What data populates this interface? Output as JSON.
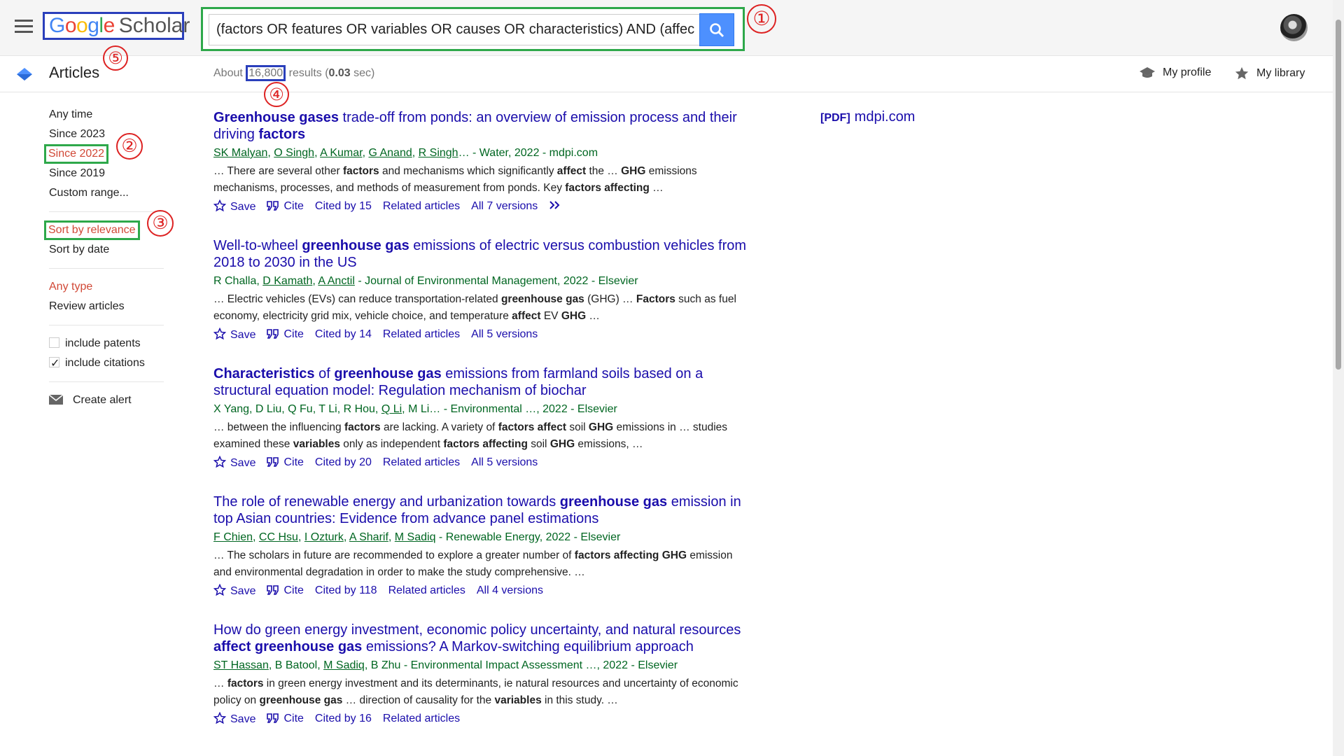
{
  "header": {
    "logo": {
      "g1": "G",
      "g2": "o",
      "g3": "o",
      "g4": "g",
      "g5": "l",
      "g6": "e",
      "scholar": "Scholar"
    },
    "search_value": "(factors OR features OR variables OR causes OR characteristics) AND (affec",
    "annotation_1": "①",
    "annotation_5": "⑤"
  },
  "subbar": {
    "section": "Articles",
    "results_prefix": "About ",
    "results_count": "16,800",
    "results_suffix": " results (",
    "results_time": "0.03",
    "results_end": " sec)",
    "annotation_4": "④",
    "my_profile": "My profile",
    "my_library": "My library"
  },
  "sidebar": {
    "time_filters": [
      "Any time",
      "Since 2023",
      "Since 2022",
      "Since 2019",
      "Custom range..."
    ],
    "annotation_2": "②",
    "sort_relevance": "Sort by relevance",
    "annotation_3": "③",
    "sort_date": "Sort by date",
    "type_any": "Any type",
    "type_review": "Review articles",
    "include_patents": "include patents",
    "include_citations": "include citations",
    "create_alert": "Create alert"
  },
  "pdf_link": {
    "tag": "[PDF]",
    "domain": "mdpi.com"
  },
  "actions": {
    "save": "Save",
    "cite": "Cite"
  },
  "results": [
    {
      "t1": "Greenhouse gases",
      "t2": " trade-off from ponds: an overview of emission process and their driving ",
      "t3": "factors",
      "t4": "",
      "a1": "SK Malyan",
      "a2": "O Singh",
      "a3": "A Kumar",
      "a4": "G Anand",
      "a5": "R Singh",
      "a6": "… - Water, 2022 - mdpi.com",
      "s1": "… There are several other ",
      "s2": "factors",
      "s3": " and mechanisms which significantly ",
      "s4": "affect",
      "s5": " the … ",
      "s6": "GHG",
      "s7": " emissions mechanisms, processes, and methods of measurement from ponds. Key ",
      "s8": "factors affecting",
      "s9": " …",
      "cited": "Cited by 15",
      "related": "Related articles",
      "versions": "All 7 versions"
    },
    {
      "t1": "Well-to-wheel ",
      "t2": "greenhouse gas",
      "t3": " emissions of electric versus combustion vehicles from 2018 to 2030 in the US",
      "t4": "",
      "a1": "R Challa, ",
      "a2": "D Kamath",
      "a3": "A Anctil",
      "a4": " - Journal of Environmental Management, 2022 - Elsevier",
      "s1": "… Electric vehicles (EVs) can reduce transportation-related ",
      "s2": "greenhouse gas",
      "s3": " (GHG) … ",
      "s4": "Factors",
      "s5": " such as fuel economy, electricity grid mix, vehicle choice, and temperature ",
      "s6": "affect",
      "s7": " EV ",
      "s8": "GHG",
      "s9": " …",
      "cited": "Cited by 14",
      "related": "Related articles",
      "versions": "All 5 versions"
    },
    {
      "t1": "Characteristics",
      "t2": " of ",
      "t3": "greenhouse gas",
      "t4": " emissions from farmland soils based on a structural equation model: Regulation mechanism of biochar",
      "a1": "X Yang, D Liu, Q Fu, T Li, R Hou, ",
      "a2": "Q Li",
      "a3": ", M Li… - Environmental …, 2022 - Elsevier",
      "s1": "… between the influencing ",
      "s2": "factors",
      "s3": " are lacking. A variety of ",
      "s4": "factors affect",
      "s5": " soil ",
      "s6": "GHG",
      "s7": " emissions in … studies examined these ",
      "s8": "variables",
      "s9": " only as independent ",
      "s10": "factors affecting",
      "s11": " soil ",
      "s12": "GHG",
      "s13": " emissions, …",
      "cited": "Cited by 20",
      "related": "Related articles",
      "versions": "All 5 versions"
    },
    {
      "t1": "The role of renewable energy and urbanization towards ",
      "t2": "greenhouse gas",
      "t3": " emission in top Asian countries: Evidence from advance panel estimations",
      "t4": "",
      "a1": "F Chien",
      "a2": "CC Hsu",
      "a3": "I Ozturk",
      "a4": "A Sharif",
      "a5": "M Sadiq",
      "a6": " - Renewable Energy, 2022 - Elsevier",
      "s1": "… The scholars in future are recommended to explore a greater number of ",
      "s2": "factors affecting",
      "s3": " ",
      "s4": "GHG",
      "s5": " emission and environmental degradation in order to make the study comprehensive. …",
      "cited": "Cited by 118",
      "related": "Related articles",
      "versions": "All 4 versions"
    },
    {
      "t1": "How do green energy investment, economic policy uncertainty, and natural resources ",
      "t2": "affect greenhouse gas",
      "t3": " emissions? A Markov-switching equilibrium approach",
      "t4": "",
      "a1": "ST Hassan",
      "a2": ", B Batool, ",
      "a3": "M Sadiq",
      "a4": ", B Zhu - Environmental Impact Assessment …, 2022 - Elsevier",
      "s1": "… ",
      "s2": "factors",
      "s3": " in green energy investment and its determinants, ie natural resources and uncertainty of economic policy on ",
      "s4": "greenhouse gas",
      "s5": " … direction of causality for the ",
      "s6": "variables",
      "s7": " in this study. …",
      "cited": "Cited by 16",
      "related": "Related articles"
    }
  ],
  "colors": {
    "link": "#1a0dab",
    "author_green": "#006621",
    "accent_red": "#d14836",
    "search_blue": "#4d90fe",
    "annotation_red": "#dd2222",
    "box_green": "#2ea84a",
    "box_blue": "#2a3fbb"
  }
}
